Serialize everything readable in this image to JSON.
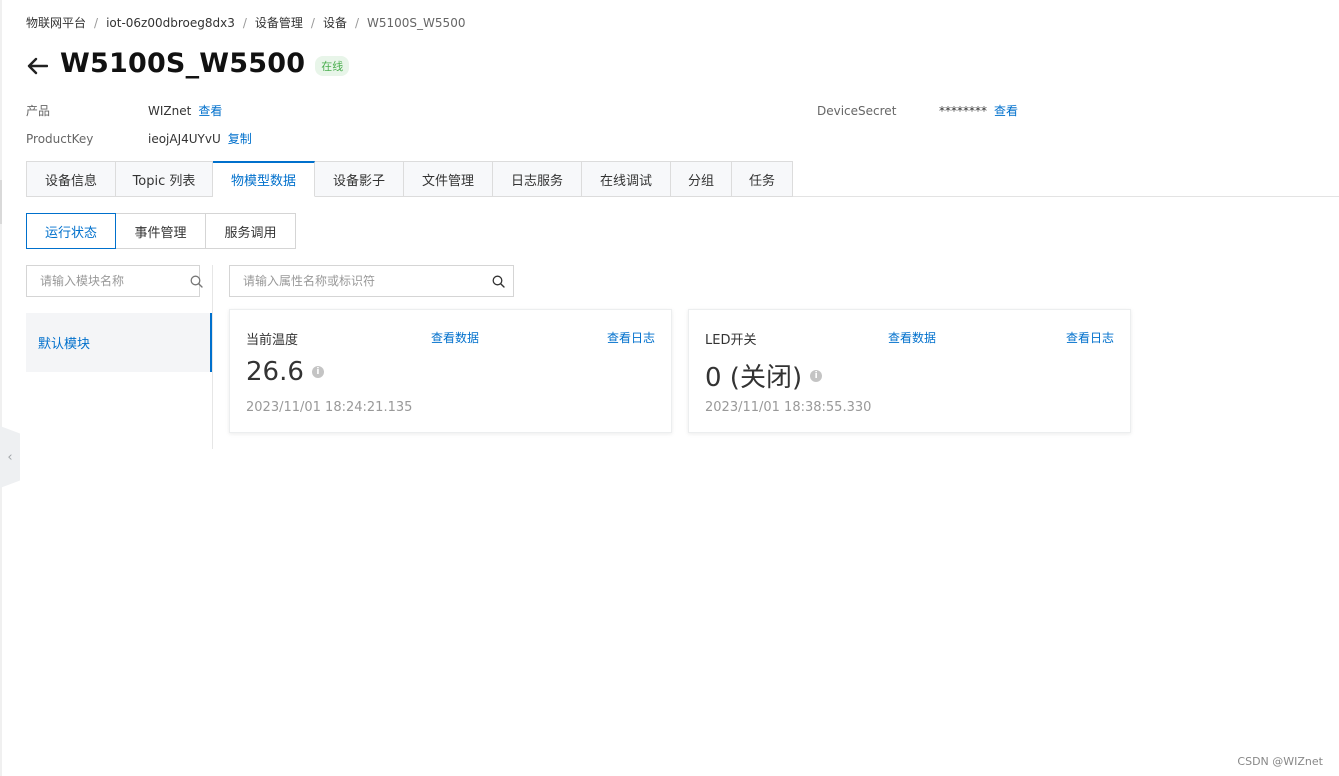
{
  "breadcrumb": {
    "items": [
      "物联网平台",
      "iot-06z00dbroeg8dx3",
      "设备管理",
      "设备"
    ],
    "current": "W5100S_W5500",
    "separator": "/"
  },
  "header": {
    "title": "W5100S_W5500",
    "status": "在线"
  },
  "info": {
    "product_label": "产品",
    "product_value": "WIZnet",
    "product_link": "查看",
    "productkey_label": "ProductKey",
    "productkey_value": "ieojAJ4UYvU",
    "productkey_link": "复制",
    "secret_label": "DeviceSecret",
    "secret_value": "********",
    "secret_link": "查看"
  },
  "tabs": [
    "设备信息",
    "Topic 列表",
    "物模型数据",
    "设备影子",
    "文件管理",
    "日志服务",
    "在线调试",
    "分组",
    "任务"
  ],
  "subtabs": [
    "运行状态",
    "事件管理",
    "服务调用"
  ],
  "module_search": {
    "placeholder": "请输入模块名称"
  },
  "property_search": {
    "placeholder": "请输入属性名称或标识符"
  },
  "modules": {
    "default": "默认模块"
  },
  "properties": [
    {
      "name": "当前温度",
      "view_data": "查看数据",
      "view_log": "查看日志",
      "value": "26.6",
      "time": "2023/11/01 18:24:21.135"
    },
    {
      "name": "LED开关",
      "view_data": "查看数据",
      "view_log": "查看日志",
      "value": "0 (关闭)",
      "time": "2023/11/01 18:38:55.330"
    }
  ],
  "watermark": "CSDN @WIZnet",
  "colors": {
    "accent": "#0070cc",
    "status_bg": "#e8f5e9",
    "status_text": "#4caf50"
  }
}
